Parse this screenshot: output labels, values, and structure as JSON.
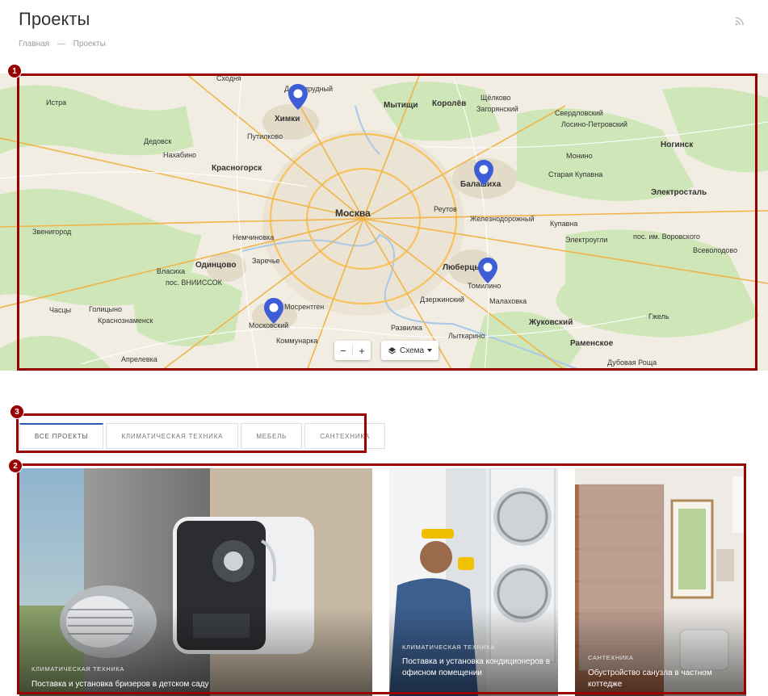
{
  "page": {
    "title": "Проекты",
    "breadcrumb": [
      {
        "label": "Главная"
      },
      {
        "separator": "—"
      },
      {
        "label": "Проекты"
      }
    ]
  },
  "map": {
    "labels": {
      "moscow": "Москва",
      "khimki": "Химки",
      "mytishchi": "Мытищи",
      "korolev": "Королёв",
      "shchelkovo": "Щёлково",
      "balashikha": "Балашиха",
      "lyubertsy": "Люберцы",
      "tomilino": "Томилино",
      "moskovsky": "Московский",
      "krasnogorsk": "Красногорск",
      "odintsovo": "Одинцово",
      "reutov": "Реутов",
      "zheleznodorozhny": "Железнодорожный",
      "zhukovsky": "Жуковский",
      "ramenskoe": "Раменское",
      "noginsk": "Ногинск",
      "elektrostal": "Электросталь",
      "dolgoprudny": "Долгопрудный",
      "zvenigorod": "Звенигород",
      "istra": "Истра",
      "dedovsk": "Дедовск",
      "nakhabino": "Нахабино",
      "putilkovo": "Путилково",
      "nemchinovka": "Немчиновка",
      "zarechye": "Заречье",
      "vlasikha": "Власиха",
      "vniissok": "пос. ВНИИССОК",
      "golitsyno": "Голицыно",
      "krasnoznamensk": "Краснознаменск",
      "aprelevka": "Апрелевка",
      "kommunarka": "Коммунарка",
      "mosrentgen": "Мосрентген",
      "razvilka": "Развилка",
      "lytkarino": "Лыткарино",
      "dzerzhinsky": "Дзержинский",
      "malakhovka": "Малаховка",
      "kupavna": "Купавна",
      "staraya_kupavna": "Старая Купавна",
      "elektrougli": "Электроугли",
      "vorovskogo": "пос. им. Воровского",
      "monino": "Монино",
      "losino": "Лосино-Петровский",
      "sverdlovsky": "Свердловский",
      "zagoryansky": "Загорянский",
      "chastsy": "Часцы",
      "skhodnya": "Сходня",
      "zhukovsky_lbl": "Жуковский",
      "dubovaya": "Дубовая Роща",
      "vsevolodovo": "Всеволодово",
      "gzhel": "Гжель"
    },
    "controls": {
      "zoom_out": "−",
      "zoom_in": "+",
      "layer": "Схема"
    }
  },
  "tabs": [
    {
      "label": "Все проекты",
      "active": true
    },
    {
      "label": "Климатическая техника",
      "active": false
    },
    {
      "label": "Мебель",
      "active": false
    },
    {
      "label": "Сантехника",
      "active": false
    }
  ],
  "projects": [
    {
      "category": "Климатическая техника",
      "title": "Поставка и установка бризеров в детском саду"
    },
    {
      "category": "Климатическая техника",
      "title": "Поставка и установка кондиционеров в офисном помещении"
    },
    {
      "category": "Сантехника",
      "title": "Обустройство санузла в частном коттедже"
    }
  ],
  "annotations": [
    "1",
    "2",
    "3"
  ],
  "colors": {
    "accent": "#3058b6",
    "pin": "#3d5ed6",
    "annotation": "#9b0000"
  }
}
